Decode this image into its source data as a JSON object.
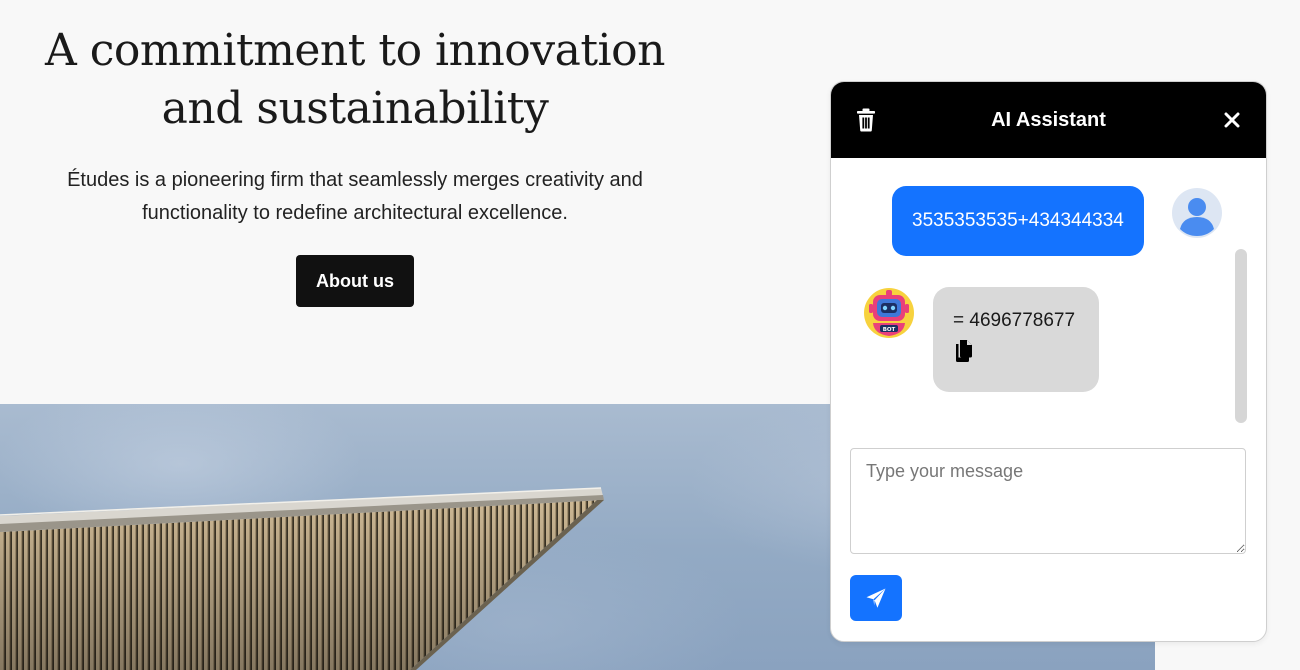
{
  "hero": {
    "title_line1": "A commitment to innovation",
    "title_line2": "and sustainability",
    "description_line1": "Études is a pioneering firm that seamlessly merges creativity and",
    "description_line2": "functionality to redefine architectural excellence.",
    "button_label": "About us"
  },
  "chat": {
    "title": "AI Assistant",
    "icons": {
      "delete": "trash-icon",
      "close": "close-icon",
      "user_avatar": "user-avatar-icon",
      "bot_avatar": "bot-avatar-icon",
      "copy": "copy-icon",
      "send": "send-icon"
    },
    "messages": [
      {
        "role": "user",
        "text": "3535353535+434344334"
      },
      {
        "role": "bot",
        "text": "= 4696778677"
      }
    ],
    "input": {
      "placeholder": "Type your message",
      "value": ""
    },
    "colors": {
      "header_bg": "#000000",
      "user_bubble": "#1473ff",
      "bot_bubble": "#d9d9d9",
      "send_button": "#1473ff"
    }
  }
}
